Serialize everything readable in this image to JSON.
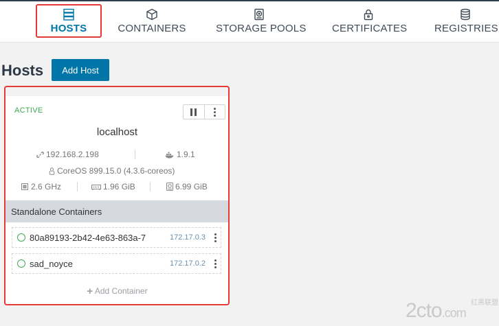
{
  "nav": {
    "items": [
      {
        "label": "HOSTS",
        "icon": "server-icon"
      },
      {
        "label": "CONTAINERS",
        "icon": "cube-icon"
      },
      {
        "label": "STORAGE POOLS",
        "icon": "hard-drive-icon"
      },
      {
        "label": "CERTIFICATES",
        "icon": "lock-icon"
      },
      {
        "label": "REGISTRIES",
        "icon": "database-icon"
      }
    ],
    "active": "HOSTS",
    "accent": "#0075a8"
  },
  "page": {
    "title": "Hosts",
    "add_host_label": "Add Host"
  },
  "host": {
    "status": "ACTIVE",
    "name": "localhost",
    "ip": "192.168.2.198",
    "docker_version": "1.9.1",
    "os": "CoreOS 899.15.0 (4.3.6-coreos)",
    "cpu": "2.6 GHz",
    "memory": "1.96 GiB",
    "storage": "6.99 GiB"
  },
  "containers": {
    "header": "Standalone Containers",
    "items": [
      {
        "name": "80a89193-2b42-4e63-863a-7",
        "ip": "172.17.0.3"
      },
      {
        "name": "sad_noyce",
        "ip": "172.17.0.2"
      }
    ],
    "add_label": "Add Container"
  },
  "colors": {
    "highlight": "#e53935",
    "active_status": "#3cab4f"
  },
  "watermark": {
    "text": "2cto",
    "suffix": ".com",
    "small": "红黑联盟"
  }
}
